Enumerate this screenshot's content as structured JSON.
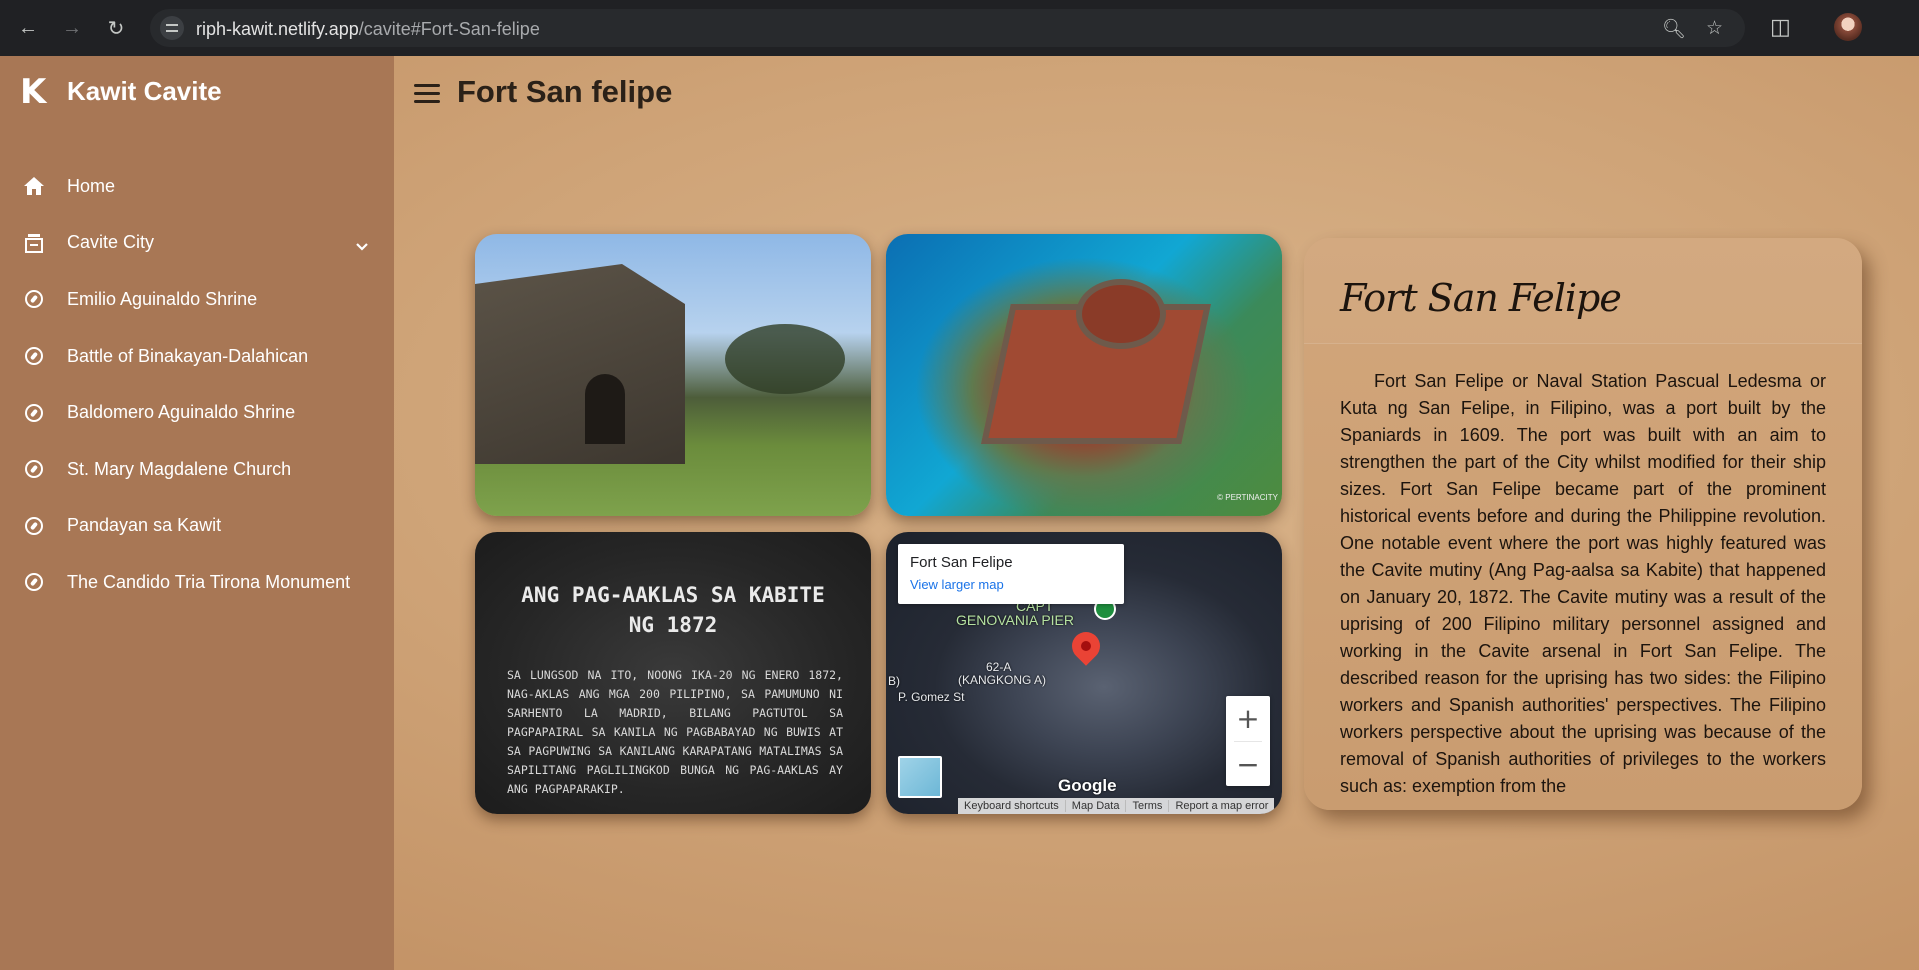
{
  "browser": {
    "url_host": "riph-kawit.netlify.app",
    "url_path": "/cavite#Fort-San-felipe",
    "back_label": "←",
    "forward_label": "→",
    "reload_label": "↻"
  },
  "sidebar": {
    "logo": "K",
    "brand": "Kawit Cavite",
    "items": [
      {
        "label": "Home",
        "icon": "home-icon"
      },
      {
        "label": "Cavite City",
        "icon": "building-icon",
        "expandable": true
      },
      {
        "label": "Emilio Aguinaldo Shrine",
        "icon": "compass-icon"
      },
      {
        "label": "Battle of Binakayan-Dalahican",
        "icon": "compass-icon"
      },
      {
        "label": "Baldomero Aguinaldo Shrine",
        "icon": "compass-icon"
      },
      {
        "label": "St. Mary Magdalene Church",
        "icon": "compass-icon"
      },
      {
        "label": "Pandayan sa Kawit",
        "icon": "compass-icon"
      },
      {
        "label": "The Candido Tria Tirona Monument",
        "icon": "compass-icon"
      }
    ]
  },
  "header": {
    "title": "Fort San felipe"
  },
  "gallery": {
    "plaque_title_1": "ANG PAG-AAKLAS SA KABITE",
    "plaque_title_2": "NG 1872",
    "plaque_body": "SA LUNGSOD NA ITO, NOONG IKA-20 NG ENERO 1872, NAG-AKLAS ANG MGA 200 PILIPINO, SA PAMUMUNO NI SARHENTO LA MADRID, BILANG PAGTUTOL SA PAGPAPAIRAL SA KANILA NG PAGBABAYAD NG BUWIS AT SA PAGPUWING SA KANILANG KARAPATANG MATALIMAS SA SAPILITANG PAGLILINGKOD BUNGA NG PAG-AAKLAS AY ANG PAGPAPARAKIP.",
    "photo_credit": "© PERTINACITY"
  },
  "map": {
    "place_name": "Fort San Felipe",
    "link": "View larger map",
    "labels": {
      "pier": "GENOVANIA PIER",
      "capt": "CAPT",
      "area_62a": "62-A",
      "kangkong": "(KANGKONG A)",
      "gomez": "P. Gomez St",
      "b": "B)"
    },
    "zoom_in": "+",
    "zoom_out": "−",
    "logo": "Google",
    "footer": [
      "Keyboard shortcuts",
      "Map Data",
      "Terms",
      "Report a map error"
    ]
  },
  "info": {
    "title": "Fort San Felipe",
    "body": "Fort San Felipe or Naval Station Pascual Ledesma or Kuta ng San Felipe, in Filipino, was a port built by the Spaniards in 1609. The port was built with an aim to strengthen the part of the City whilst modified for their ship sizes. Fort San Felipe became part of the prominent historical events before and during the Philippine revolution. One notable event where the port was highly featured was the Cavite mutiny (Ang Pag-aalsa sa Kabite) that happened on January 20, 1872. The Cavite mutiny was a result of the uprising of 200 Filipino military personnel assigned and working in the Cavite arsenal in Fort San Felipe. The described reason for the uprising has two sides: the Filipino workers and Spanish authorities' perspectives. The Filipino workers perspective about the uprising was because of the removal of Spanish authorities of privileges to the workers such as: exemption from the"
  }
}
